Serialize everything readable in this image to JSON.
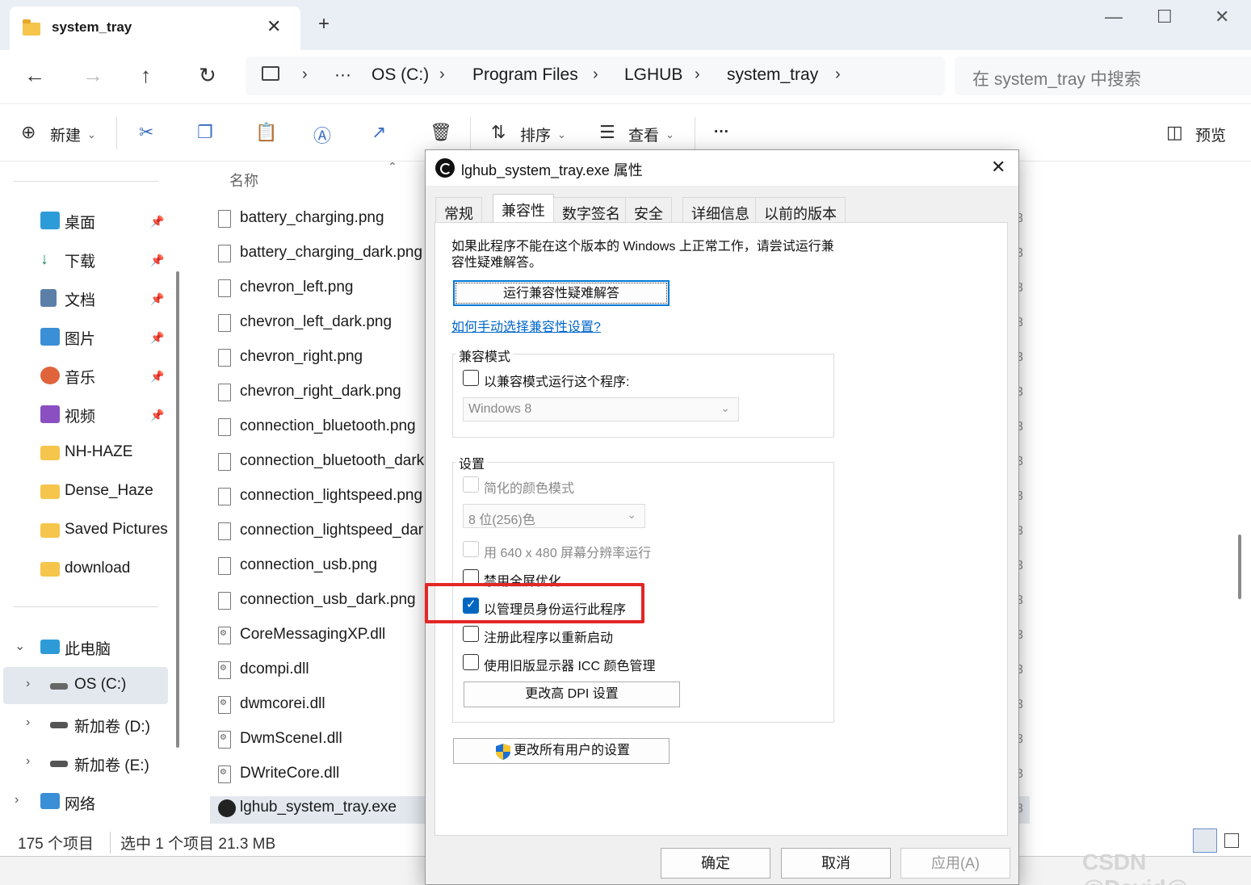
{
  "window": {
    "tab_title": "system_tray",
    "tab_close": "✕",
    "new_tab": "+",
    "controls": [
      "—",
      "☐",
      "✕"
    ]
  },
  "nav": {
    "back": "←",
    "forward": "→",
    "up": "↑",
    "refresh": "↻",
    "breadcrumbs": [
      "OS (C:)",
      "Program Files",
      "LGHUB",
      "system_tray"
    ],
    "overflow": "···",
    "search_placeholder": "在 system_tray 中搜索"
  },
  "toolbar": {
    "new_label": "新建",
    "sort_label": "排序",
    "view_label": "查看",
    "more": "···",
    "preview_label": "预览"
  },
  "sidebar": {
    "pinned": [
      {
        "label": "桌面",
        "icon": "desktop-icon",
        "color": "#2e9bd9"
      },
      {
        "label": "下载",
        "icon": "download-icon",
        "color": "#1e8a5e"
      },
      {
        "label": "文档",
        "icon": "document-icon",
        "color": "#5c7fa8"
      },
      {
        "label": "图片",
        "icon": "pictures-icon",
        "color": "#3b8fd6"
      },
      {
        "label": "音乐",
        "icon": "music-icon",
        "color": "#e0643b"
      },
      {
        "label": "视频",
        "icon": "video-icon",
        "color": "#8a4fc1"
      }
    ],
    "folders": [
      "NH-HAZE",
      "Dense_Haze",
      "Saved Pictures",
      "download"
    ],
    "this_pc": "此电脑",
    "drives": [
      "OS (C:)",
      "新加卷 (D:)",
      "新加卷 (E:)"
    ],
    "network": "网络"
  },
  "files": {
    "column_name": "名称",
    "items": [
      {
        "name": "battery_charging.png",
        "type": "file"
      },
      {
        "name": "battery_charging_dark.png",
        "type": "file"
      },
      {
        "name": "chevron_left.png",
        "type": "file"
      },
      {
        "name": "chevron_left_dark.png",
        "type": "file"
      },
      {
        "name": "chevron_right.png",
        "type": "file"
      },
      {
        "name": "chevron_right_dark.png",
        "type": "file"
      },
      {
        "name": "connection_bluetooth.png",
        "type": "file"
      },
      {
        "name": "connection_bluetooth_dark",
        "type": "file"
      },
      {
        "name": "connection_lightspeed.png",
        "type": "file"
      },
      {
        "name": "connection_lightspeed_dar",
        "type": "file"
      },
      {
        "name": "connection_usb.png",
        "type": "file"
      },
      {
        "name": "connection_usb_dark.png",
        "type": "file"
      },
      {
        "name": "CoreMessagingXP.dll",
        "type": "dll"
      },
      {
        "name": "dcompi.dll",
        "type": "dll"
      },
      {
        "name": "dwmcorei.dll",
        "type": "dll"
      },
      {
        "name": "DwmSceneI.dll",
        "type": "dll"
      },
      {
        "name": "DWriteCore.dll",
        "type": "dll"
      },
      {
        "name": "lghub_system_tray.exe",
        "type": "exe",
        "selected": true
      }
    ],
    "size_glyph": "3"
  },
  "status": {
    "count": "175 个项目",
    "selection": "选中 1 个项目  21.3 MB"
  },
  "dialog": {
    "title": "lghub_system_tray.exe 属性",
    "close": "✕",
    "tabs": [
      "常规",
      "兼容性",
      "数字签名",
      "安全",
      "详细信息",
      "以前的版本"
    ],
    "active_tab": "兼容性",
    "intro": "如果此程序不能在这个版本的 Windows 上正常工作，请尝试运行兼容性疑难解答。",
    "intro_line1": "如果此程序不能在这个版本的 Windows 上正常工作，请尝试运行兼",
    "intro_line2": "容性疑难解答。",
    "troubleshoot_btn": "运行兼容性疑难解答",
    "manual_link": "如何手动选择兼容性设置?",
    "compat_group": "兼容模式",
    "compat_check": "以兼容模式运行这个程序:",
    "compat_os": "Windows 8",
    "settings_group": "设置",
    "reduced_color": "简化的颜色模式",
    "color_select": "8 位(256)色",
    "res640": "用 640 x 480 屏幕分辨率运行",
    "disable_fullscreen": "禁用全屏优化",
    "run_as_admin": "以管理员身份运行此程序",
    "register_restart": "注册此程序以重新启动",
    "legacy_icc": "使用旧版显示器 ICC 颜色管理",
    "dpi_btn": "更改高 DPI 设置",
    "all_users_btn": "更改所有用户的设置",
    "ok": "确定",
    "cancel": "取消",
    "apply": "应用(A)"
  },
  "watermark": "CSDN @David@"
}
